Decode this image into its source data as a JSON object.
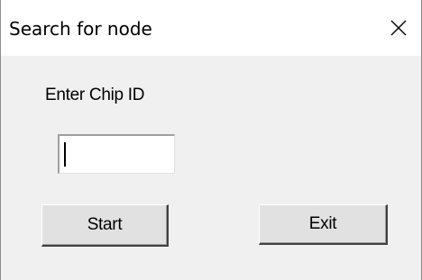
{
  "window": {
    "title": "Search for node",
    "close_icon": "close-x-icon"
  },
  "form": {
    "chip_id_label": "Enter Chip ID",
    "chip_id_value": "",
    "start_label": "Start",
    "exit_label": "Exit"
  },
  "colors": {
    "titlebar_bg": "#ffffff",
    "dialog_bg": "#f0f0f0",
    "button_bg": "#e1e1e1",
    "text": "#000000"
  }
}
